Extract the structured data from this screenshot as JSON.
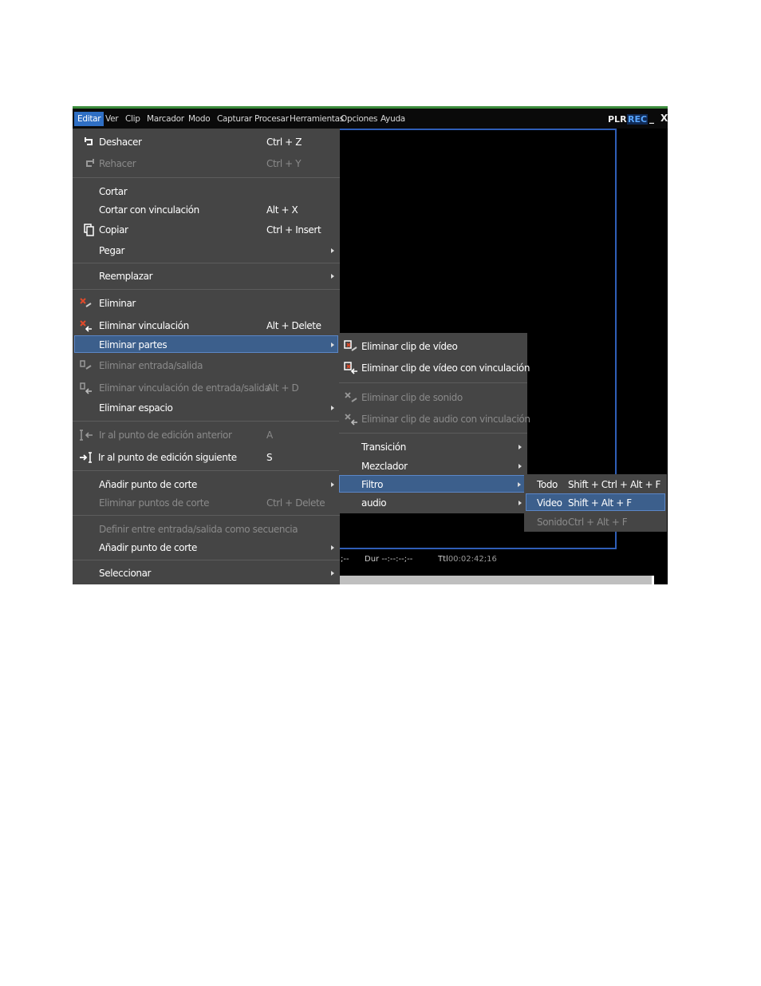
{
  "menubar": {
    "items": [
      "Editar",
      "Ver",
      "Clip",
      "Marcador",
      "Modo",
      "Capturar",
      "Procesar",
      "Herramientas",
      "Opciones",
      "Ayuda"
    ],
    "plr": "PLR",
    "rec": "REC",
    "minimize": "_",
    "close": "X"
  },
  "edit_menu": {
    "items": [
      {
        "label": "Deshacer",
        "shortcut": "Ctrl + Z",
        "enabled": true,
        "icon": "undo-icon"
      },
      {
        "label": "Rehacer",
        "shortcut": "Ctrl + Y",
        "enabled": false,
        "icon": "redo-icon"
      },
      {
        "label": "Cortar",
        "shortcut": "",
        "enabled": true
      },
      {
        "label": "Cortar con vinculación",
        "shortcut": "Alt + X",
        "enabled": true
      },
      {
        "label": "Copiar",
        "shortcut": "Ctrl + Insert",
        "enabled": true,
        "icon": "copy-icon"
      },
      {
        "label": "Pegar",
        "shortcut": "",
        "enabled": true,
        "submenu": true
      },
      {
        "label": "Reemplazar",
        "shortcut": "",
        "enabled": true,
        "submenu": true
      },
      {
        "label": "Eliminar",
        "shortcut": "",
        "enabled": true,
        "icon": "delete-icon"
      },
      {
        "label": "Eliminar vinculación",
        "shortcut": "Alt + Delete",
        "enabled": true,
        "icon": "delete-link-icon"
      },
      {
        "label": "Eliminar partes",
        "shortcut": "",
        "enabled": true,
        "submenu": true,
        "highlighted": true
      },
      {
        "label": "Eliminar entrada/salida",
        "shortcut": "",
        "enabled": false,
        "icon": "delete-inout-icon"
      },
      {
        "label": "Eliminar vinculación de entrada/salida",
        "shortcut": "Alt + D",
        "enabled": false,
        "icon": "delete-inout-link-icon"
      },
      {
        "label": "Eliminar espacio",
        "shortcut": "",
        "enabled": true,
        "submenu": true
      },
      {
        "label": "Ir al punto de edición anterior",
        "shortcut": "A",
        "enabled": false,
        "icon": "prev-edit-point-icon"
      },
      {
        "label": "Ir al punto de edición siguiente",
        "shortcut": "S",
        "enabled": true,
        "icon": "next-edit-point-icon"
      },
      {
        "label": "Añadir punto de corte",
        "shortcut": "",
        "enabled": true,
        "submenu": true
      },
      {
        "label": "Eliminar puntos de corte",
        "shortcut": "Ctrl + Delete",
        "enabled": false
      },
      {
        "label": "Definir entre entrada/salida como secuencia",
        "shortcut": "",
        "enabled": false
      },
      {
        "label": "Añadir punto de corte",
        "shortcut": "",
        "enabled": true,
        "submenu": true
      },
      {
        "label": "Seleccionar",
        "shortcut": "",
        "enabled": true,
        "submenu": true
      }
    ]
  },
  "parts_submenu": {
    "items": [
      {
        "label": "Eliminar clip de vídeo",
        "enabled": true,
        "icon": "delete-video-clip-icon"
      },
      {
        "label": "Eliminar clip de vídeo con vinculación",
        "enabled": true,
        "icon": "delete-video-clip-link-icon"
      },
      {
        "label": "Eliminar clip de sonido",
        "enabled": false,
        "icon": "delete-audio-clip-icon"
      },
      {
        "label": "Eliminar clip de audio con vinculación",
        "enabled": false,
        "icon": "delete-audio-clip-link-icon"
      },
      {
        "label": "Transición",
        "enabled": true,
        "submenu": true
      },
      {
        "label": "Mezclador",
        "enabled": true,
        "submenu": true
      },
      {
        "label": "Filtro",
        "enabled": true,
        "submenu": true,
        "highlighted": true
      },
      {
        "label": "audio",
        "enabled": true,
        "submenu": true
      }
    ]
  },
  "filter_submenu": {
    "items": [
      {
        "label": "Todo",
        "shortcut": "Shift + Ctrl + Alt + F",
        "enabled": true
      },
      {
        "label": "Video",
        "shortcut": "Shift + Alt + F",
        "enabled": true,
        "highlighted": true
      },
      {
        "label": "Sonido",
        "shortcut": "Ctrl + Alt + F",
        "enabled": false
      }
    ]
  },
  "status": {
    "sep": ";--",
    "dur": "Dur --:--:--;--",
    "ttl_label": "Ttl",
    "ttl_value": "00:02:42;16"
  },
  "colors": {
    "menubar_active": "#2f6fc4",
    "menu_bg": "#454545",
    "highlight": "#3c5f8c",
    "monitor_border": "#2f5eb8",
    "icon_red": "#e04a2a"
  }
}
